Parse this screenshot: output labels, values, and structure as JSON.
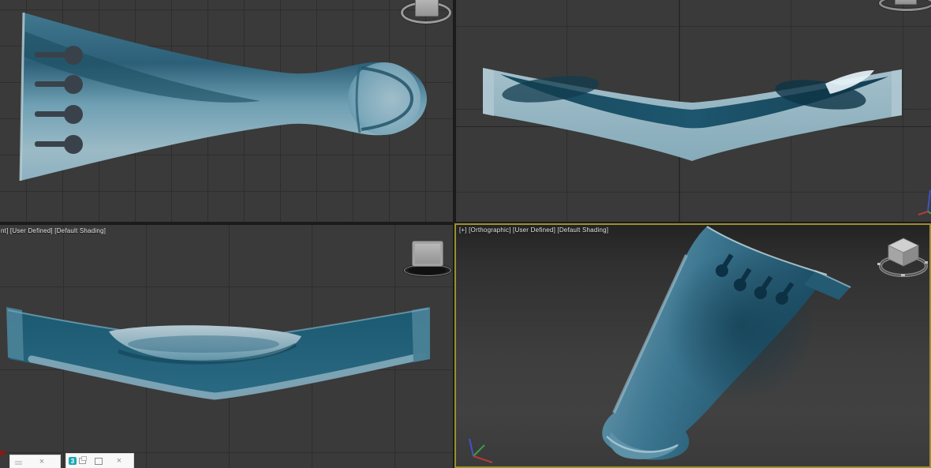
{
  "colors": {
    "viewport-bg": "#3a3a3a",
    "grid-line": "#2e2e2e",
    "grid-line-major": "#252525",
    "gap": "#1b1b1b",
    "active-border": "#9a8f2e",
    "label-text": "#e4e4e4",
    "model-light": "#93b6c4",
    "model-mid": "#36718d",
    "model-dark": "#1c5068",
    "model-shadow": "#0e3a4e",
    "keyhole": "#343d42",
    "axis-x": "#b33b3b",
    "axis-y": "#3f9b3f",
    "axis-z": "#3c55c9",
    "win-bg": "#f8f8f8",
    "win-icon-teal": "#1ba8b5"
  },
  "viewports": {
    "front": {
      "label": "nt] [User Defined] [Default Shading]"
    },
    "orthographic": {
      "label": "[+] [Orthographic] [User Defined] [Default Shading]"
    }
  },
  "windows": {
    "window1": {
      "close": "×"
    },
    "window2": {
      "badge": "3",
      "close": "×"
    }
  }
}
